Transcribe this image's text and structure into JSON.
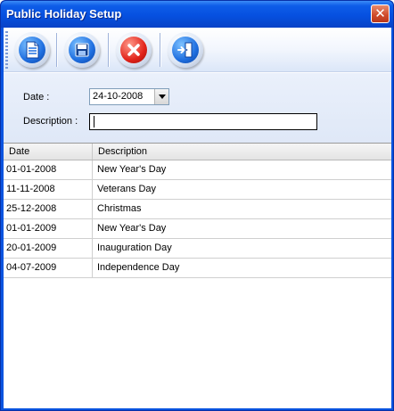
{
  "window": {
    "title": "Public Holiday Setup"
  },
  "toolbar": {
    "buttons": [
      {
        "name": "new",
        "icon": "document-icon"
      },
      {
        "name": "save",
        "icon": "floppy-disk-icon"
      },
      {
        "name": "delete",
        "icon": "red-x-icon"
      },
      {
        "name": "exit",
        "icon": "exit-door-icon"
      }
    ]
  },
  "form": {
    "date_label": "Date :",
    "date_value": "24-10-2008",
    "description_label": "Description :",
    "description_value": ""
  },
  "grid": {
    "columns": [
      "Date",
      "Description"
    ],
    "rows": [
      {
        "date": "01-01-2008",
        "description": "New Year's Day"
      },
      {
        "date": "11-11-2008",
        "description": "Veterans Day"
      },
      {
        "date": "25-12-2008",
        "description": "Christmas"
      },
      {
        "date": "01-01-2009",
        "description": "New Year's Day"
      },
      {
        "date": "20-01-2009",
        "description": "Inauguration Day"
      },
      {
        "date": "04-07-2009",
        "description": "Independence Day"
      }
    ]
  },
  "colors": {
    "titlebar": "#0650e0",
    "accent": "#1f6fe0",
    "delete": "#e2231a"
  }
}
